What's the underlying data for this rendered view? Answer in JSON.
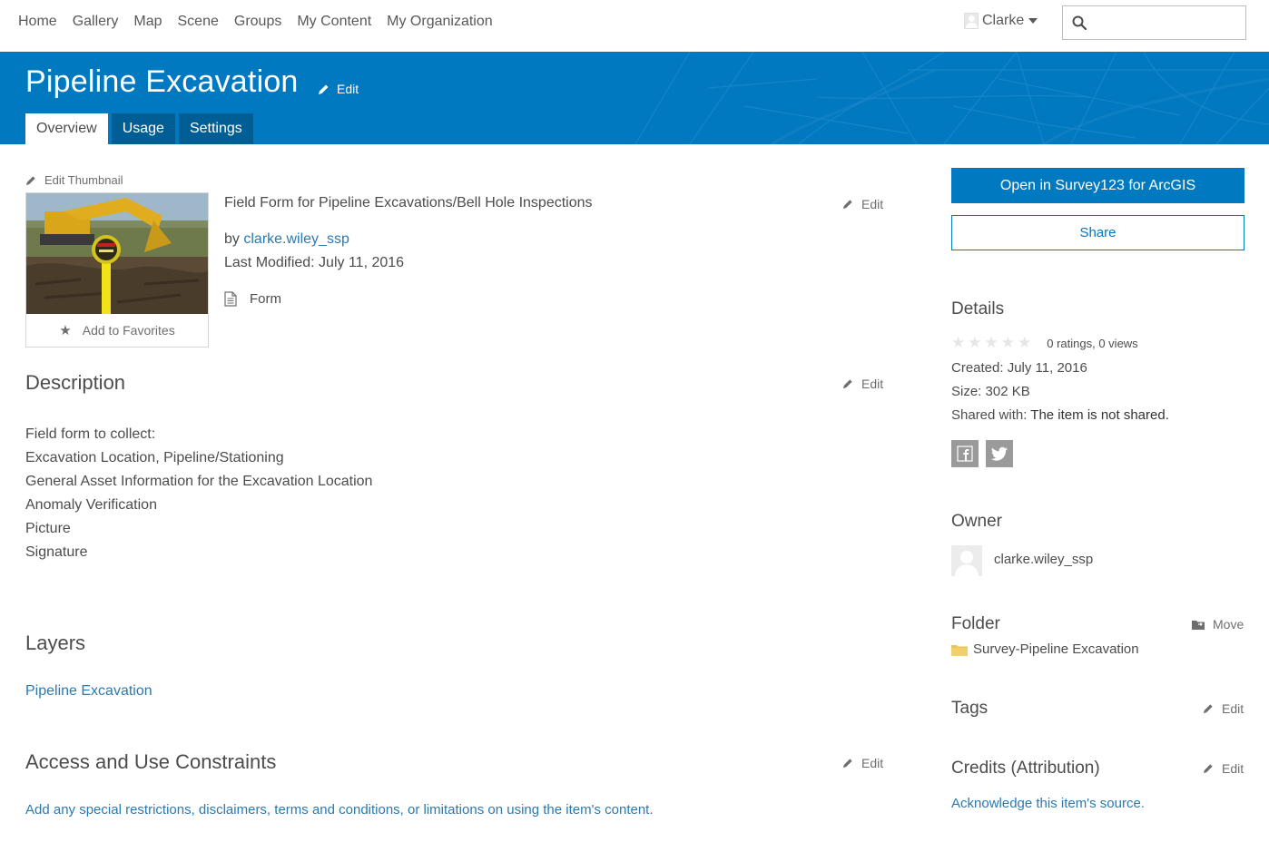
{
  "nav": {
    "items": [
      "Home",
      "Gallery",
      "Map",
      "Scene",
      "Groups",
      "My Content",
      "My Organization"
    ],
    "user_name": "Clarke",
    "search_placeholder": ""
  },
  "banner": {
    "title": "Pipeline Excavation",
    "edit_label": "Edit",
    "tabs": [
      {
        "label": "Overview",
        "active": true
      },
      {
        "label": "Usage",
        "active": false
      },
      {
        "label": "Settings",
        "active": false
      }
    ]
  },
  "item": {
    "edit_thumbnail": "Edit Thumbnail",
    "add_favorites": "Add to Favorites",
    "summary": "Field Form for Pipeline Excavations/Bell Hole Inspections",
    "edit_label": "Edit",
    "by_prefix": "by",
    "owner": "clarke.wiley_ssp",
    "last_modified": "Last Modified: July 11, 2016",
    "type": "Form"
  },
  "description": {
    "heading": "Description",
    "edit_label": "Edit",
    "lines": [
      "Field form to collect:",
      "Excavation Location, Pipeline/Stationing",
      "General Asset Information for the Excavation Location",
      "Anomaly Verification",
      "Picture",
      "Signature"
    ]
  },
  "layers": {
    "heading": "Layers",
    "items": [
      "Pipeline Excavation"
    ]
  },
  "constraints": {
    "heading": "Access and Use Constraints",
    "edit_label": "Edit",
    "placeholder": "Add any special restrictions, disclaimers, terms and conditions, or limitations on using the item's content."
  },
  "sidebar": {
    "open_button": "Open in Survey123 for ArcGIS",
    "share_button": "Share",
    "details_heading": "Details",
    "rating_count": "0 ratings, 0 views",
    "rating_value": 0,
    "rating_max": 5,
    "created": "Created: July 11, 2016",
    "size": "Size: 302 KB",
    "shared_prefix": "Shared with:",
    "shared_value": "The item is not shared.",
    "owner_heading": "Owner",
    "owner_name": "clarke.wiley_ssp",
    "folder_heading": "Folder",
    "move_label": "Move",
    "folder_name": "Survey-Pipeline Excavation",
    "tags_heading": "Tags",
    "tags_edit": "Edit",
    "credits_heading": "Credits (Attribution)",
    "credits_edit": "Edit",
    "acknowledge": "Acknowledge this item's source."
  },
  "colors": {
    "brand_blue": "#0079c1",
    "tab_dark": "#005e95",
    "link": "#2a7ab0",
    "folder": "#e8c55a"
  },
  "icons": {
    "search": "search-icon",
    "pencil": "pencil-icon",
    "star": "star-icon",
    "form": "document-icon",
    "facebook": "facebook-icon",
    "twitter": "twitter-icon",
    "folder": "folder-icon",
    "move": "move-icon"
  }
}
